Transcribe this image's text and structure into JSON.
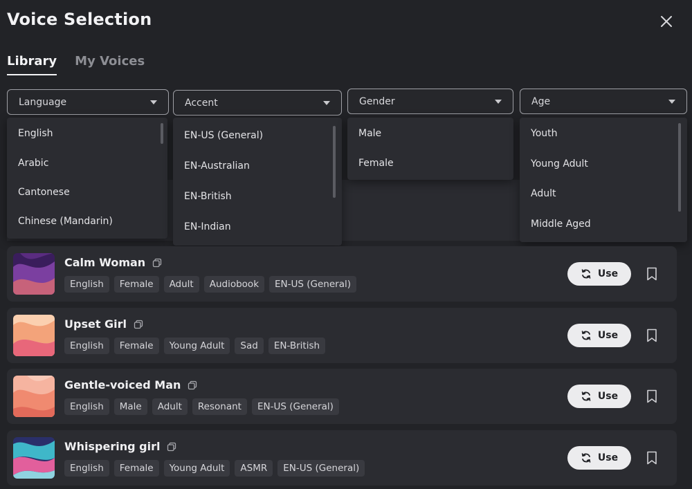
{
  "header": {
    "title": "Voice Selection",
    "close_icon": "close-icon"
  },
  "tabs": [
    {
      "label": "Library",
      "active": true
    },
    {
      "label": "My Voices",
      "active": false
    }
  ],
  "filters": {
    "language": {
      "label": "Language",
      "options": [
        "English",
        "Arabic",
        "Cantonese",
        "Chinese (Mandarin)"
      ]
    },
    "accent": {
      "label": "Accent",
      "options": [
        "EN-US (General)",
        "EN-Australian",
        "EN-British",
        "EN-Indian"
      ]
    },
    "gender": {
      "label": "Gender",
      "options": [
        "Male",
        "Female"
      ]
    },
    "age": {
      "label": "Age",
      "options": [
        "Youth",
        "Young Adult",
        "Adult",
        "Middle Aged"
      ]
    }
  },
  "voices": [
    {
      "name": "Calm Woman",
      "tags": [
        "English",
        "Female",
        "Adult",
        "Audiobook",
        "EN-US (General)"
      ],
      "use_label": "Use",
      "thumb_colors": [
        "#3a1d5c",
        "#7b3fa0",
        "#c7627a"
      ]
    },
    {
      "name": "Upset Girl",
      "tags": [
        "English",
        "Female",
        "Young Adult",
        "Sad",
        "EN-British"
      ],
      "use_label": "Use",
      "thumb_colors": [
        "#f3a37a",
        "#e8677a",
        "#fbd0b0"
      ]
    },
    {
      "name": "Gentle-voiced Man",
      "tags": [
        "English",
        "Male",
        "Adult",
        "Resonant",
        "EN-US (General)"
      ],
      "use_label": "Use",
      "thumb_colors": [
        "#f08a70",
        "#f6b4a0",
        "#e26a5a"
      ]
    },
    {
      "name": "Whispering girl",
      "tags": [
        "English",
        "Female",
        "Young Adult",
        "ASMR",
        "EN-US (General)"
      ],
      "use_label": "Use",
      "thumb_colors": [
        "#3fb7c9",
        "#e25f9c",
        "#2a2f6a"
      ]
    }
  ],
  "colors": {
    "background": "#222327",
    "card": "#2b2c31",
    "tag": "#393a40",
    "button": "#ececee"
  }
}
